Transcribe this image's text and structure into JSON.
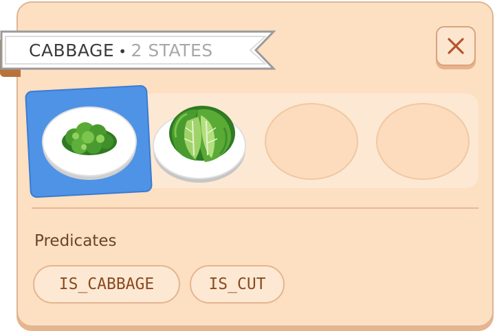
{
  "banner": {
    "name": "CABBAGE",
    "separator": "•",
    "states": "2 STATES"
  },
  "close": {
    "icon": "close-icon"
  },
  "states": [
    {
      "kind": "filled",
      "label": "cabbage-cut-state",
      "selected": true
    },
    {
      "kind": "filled",
      "label": "cabbage-whole-state",
      "selected": false
    },
    {
      "kind": "empty",
      "selected": false
    },
    {
      "kind": "empty",
      "selected": false
    }
  ],
  "predicates": {
    "title": "Predicates",
    "items": [
      "IS_CABBAGE",
      "IS_CUT"
    ]
  },
  "colors": {
    "panel": "#fddfc2",
    "selected": "#4f93e6",
    "chip_text": "#8a4a1f",
    "leaf_dark": "#3f8f2a",
    "leaf_light": "#9fd36a"
  }
}
